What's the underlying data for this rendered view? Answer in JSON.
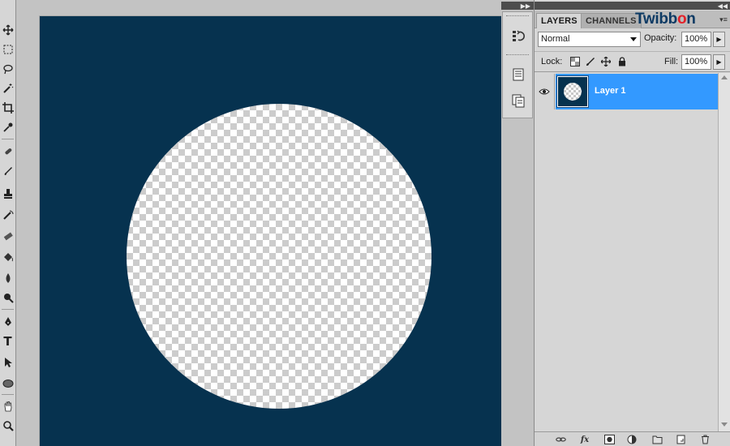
{
  "canvas": {
    "background_color": "#06324f",
    "content": "transparent circle"
  },
  "toolbox": {
    "tools": [
      "move-tool-icon",
      "marquee-tool-icon",
      "lasso-tool-icon",
      "magic-wand-tool-icon",
      "crop-tool-icon",
      "eyedropper-tool-icon",
      "healing-brush-tool-icon",
      "brush-tool-icon",
      "clone-stamp-tool-icon",
      "history-brush-tool-icon",
      "eraser-tool-icon",
      "paint-bucket-tool-icon",
      "blur-tool-icon",
      "dodge-tool-icon",
      "pen-tool-icon",
      "type-tool-icon",
      "path-selection-tool-icon",
      "shape-tool-icon",
      "hand-tool-icon",
      "zoom-tool-icon"
    ]
  },
  "layers_panel": {
    "tabs": [
      "LAYERS",
      "CHANNELS"
    ],
    "watermark_prefix": "Twibb",
    "watermark_o": "o",
    "watermark_suffix": "n",
    "blend_mode": "Normal",
    "opacity_label": "Opacity:",
    "opacity_value": "100%",
    "lock_label": "Lock:",
    "fill_label": "Fill:",
    "fill_value": "100%",
    "layers": [
      {
        "name": "Layer 1",
        "visible": true,
        "selected": true
      }
    ],
    "bottom_tools": [
      "link-layers-icon",
      "fx",
      "layer-mask-icon",
      "adjustment-layer-icon",
      "new-group-icon",
      "new-layer-icon",
      "delete-layer-icon"
    ]
  },
  "colors": {
    "selection_blue": "#3399ff",
    "logo_blue": "#0d3a64",
    "logo_red": "#e3222a"
  }
}
